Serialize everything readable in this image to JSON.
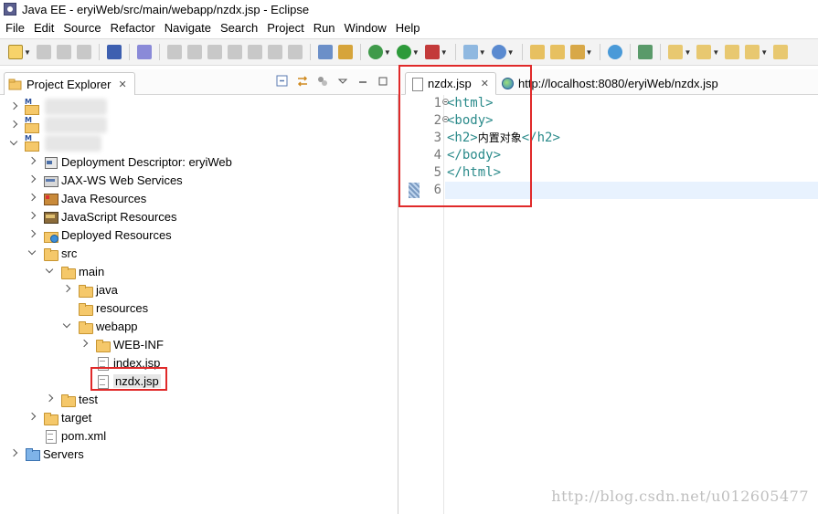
{
  "window": {
    "title": "Java EE - eryiWeb/src/main/webapp/nzdx.jsp - Eclipse"
  },
  "menu": [
    "File",
    "Edit",
    "Source",
    "Refactor",
    "Navigate",
    "Search",
    "Project",
    "Run",
    "Window",
    "Help"
  ],
  "project_explorer": {
    "tab_label": "Project Explorer",
    "tab_close": "✕",
    "tree": [
      {
        "label": "",
        "blurred": true
      },
      {
        "label": "",
        "blurred": true
      },
      {
        "label": "",
        "blurred": true
      },
      {
        "label": "Deployment Descriptor: eryiWeb"
      },
      {
        "label": "JAX-WS Web Services"
      },
      {
        "label": "Java Resources"
      },
      {
        "label": "JavaScript Resources"
      },
      {
        "label": "Deployed Resources"
      },
      {
        "label": "src"
      },
      {
        "label": "main"
      },
      {
        "label": "java"
      },
      {
        "label": "resources"
      },
      {
        "label": "webapp"
      },
      {
        "label": "WEB-INF"
      },
      {
        "label": "index.jsp"
      },
      {
        "label": "nzdx.jsp"
      },
      {
        "label": "test"
      },
      {
        "label": "target"
      },
      {
        "label": "pom.xml"
      },
      {
        "label": "Servers"
      }
    ]
  },
  "editor": {
    "tabs": [
      {
        "label": "nzdx.jsp",
        "close": "✕"
      },
      {
        "label": "http://localhost:8080/eryiWeb/nzdx.jsp"
      }
    ],
    "line_numbers": [
      "1",
      "2",
      "3",
      "4",
      "5",
      "6"
    ],
    "lines": [
      {
        "parts": [
          {
            "t": "tag",
            "v": "<html>"
          }
        ]
      },
      {
        "parts": [
          {
            "t": "tag",
            "v": "<body>"
          }
        ]
      },
      {
        "parts": [
          {
            "t": "tag",
            "v": "<h2>"
          },
          {
            "t": "txt",
            "v": "内置对象"
          },
          {
            "t": "tag",
            "v": "</h2>"
          }
        ]
      },
      {
        "parts": [
          {
            "t": "tag",
            "v": "</body>"
          }
        ]
      },
      {
        "parts": [
          {
            "t": "tag",
            "v": "</html>"
          }
        ]
      },
      {
        "parts": []
      }
    ]
  },
  "watermark": "http://blog.csdn.net/u012605477"
}
